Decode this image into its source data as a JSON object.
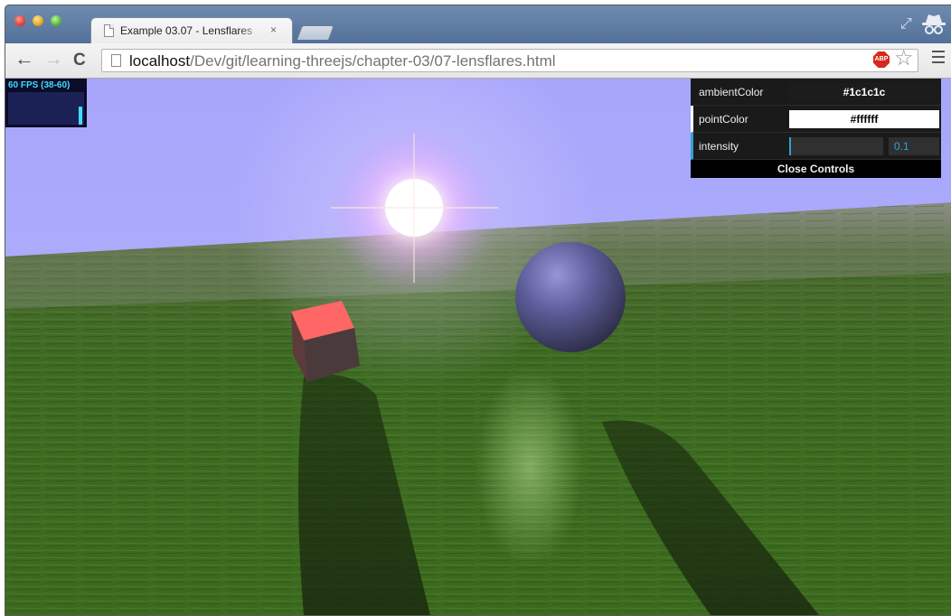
{
  "browser": {
    "tab": {
      "title": "Example 03.07 - Lensflares",
      "close_glyph": "×"
    },
    "icons": {
      "back": "back-arrow-icon",
      "forward": "forward-arrow-icon",
      "reload": "reload-icon",
      "page": "page-icon",
      "adblock": "adblock-icon",
      "bookmark": "star-icon",
      "menu": "hamburger-menu-icon",
      "restore": "restore-window-icon",
      "incognito": "incognito-icon"
    },
    "url": {
      "host": "localhost",
      "path": "/Dev/git/learning-threejs/chapter-03/07-lensflares.html"
    },
    "adblock_label": "ABP",
    "glyphs": {
      "back": "←",
      "forward": "→",
      "reload": "C",
      "star": "☆",
      "restore": "⤢"
    }
  },
  "stats": {
    "text": "60 FPS (38-60)"
  },
  "gui": {
    "controls": [
      {
        "label": "ambientColor",
        "value": "#1c1c1c"
      },
      {
        "label": "pointColor",
        "value": "#ffffff"
      },
      {
        "label": "intensity",
        "value": "0.1",
        "fraction": 0.02
      }
    ],
    "close_label": "Close Controls"
  },
  "colors": {
    "ambientColor": "#1c1c1c",
    "pointColor": "#ffffff",
    "sky": "#a7a6fb",
    "slider": "#2fa1d6",
    "cube": "#e24a4a",
    "sphere": "#55558f"
  }
}
